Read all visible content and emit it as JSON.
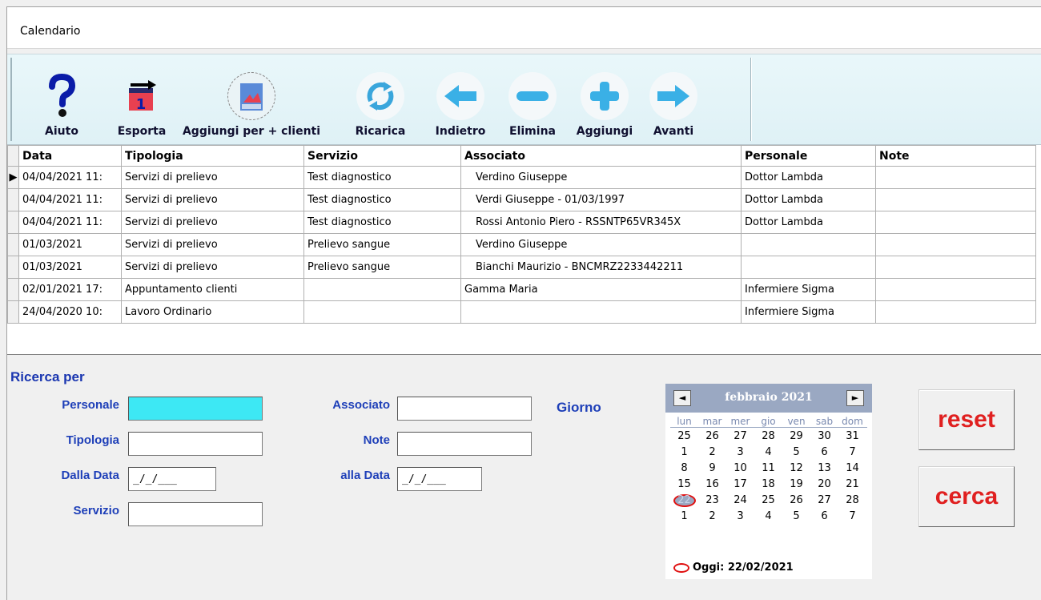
{
  "window": {
    "title": "Calendario"
  },
  "toolbar": {
    "buttons": [
      {
        "label": "Aiuto",
        "icon": "help-icon"
      },
      {
        "label": "Esporta",
        "icon": "export-icon"
      },
      {
        "label": "Aggiungi per + clienti",
        "icon": "add-multi-clients-icon"
      },
      {
        "label": "Ricarica",
        "icon": "reload-icon"
      },
      {
        "label": "Indietro",
        "icon": "arrow-left-icon"
      },
      {
        "label": "Elimina",
        "icon": "minus-icon"
      },
      {
        "label": "Aggiungi",
        "icon": "plus-icon"
      },
      {
        "label": "Avanti",
        "icon": "arrow-right-icon"
      }
    ]
  },
  "grid": {
    "columns": [
      "Data",
      "Tipologia",
      "Servizio",
      "Associato",
      "Personale",
      "Note"
    ],
    "rows": [
      {
        "data": "04/04/2021 11:",
        "tipologia": "Servizi di prelievo",
        "servizio": "Test diagnostico",
        "associato": "Verdino Giuseppe",
        "personale": "Dottor Lambda",
        "note": ""
      },
      {
        "data": "04/04/2021 11:",
        "tipologia": "Servizi di prelievo",
        "servizio": "Test diagnostico",
        "associato": "Verdi Giuseppe - 01/03/1997",
        "personale": "Dottor Lambda",
        "note": ""
      },
      {
        "data": "04/04/2021 11:",
        "tipologia": "Servizi di prelievo",
        "servizio": "Test diagnostico",
        "associato": "Rossi Antonio Piero - RSSNTP65VR345X",
        "personale": "Dottor Lambda",
        "note": ""
      },
      {
        "data": "01/03/2021",
        "tipologia": "Servizi di prelievo",
        "servizio": "Prelievo sangue",
        "associato": "Verdino Giuseppe",
        "personale": "",
        "note": ""
      },
      {
        "data": "01/03/2021",
        "tipologia": "Servizi di prelievo",
        "servizio": "Prelievo sangue",
        "associato": "Bianchi Maurizio - BNCMRZ2233442211",
        "personale": "",
        "note": ""
      },
      {
        "data": "02/01/2021 17:",
        "tipologia": "Appuntamento clienti",
        "servizio": "",
        "associato": "Gamma Maria",
        "personale": "Infermiere Sigma",
        "note": ""
      },
      {
        "data": "24/04/2020 10:",
        "tipologia": "Lavoro Ordinario",
        "servizio": "",
        "associato": "",
        "personale": "Infermiere Sigma",
        "note": ""
      }
    ]
  },
  "search": {
    "title": "Ricerca per",
    "personale_label": "Personale",
    "tipologia_label": "Tipologia",
    "dalla_data_label": "Dalla Data",
    "servizio_label": "Servizio",
    "associato_label": "Associato",
    "note_label": "Note",
    "alla_data_label": "alla Data",
    "giorno_label": "Giorno",
    "personale_value": "",
    "tipologia_value": "",
    "dalla_data_value": "_/_/___",
    "servizio_value": "",
    "associato_value": "",
    "note_value": "",
    "alla_data_value": "_/_/___"
  },
  "calendar": {
    "month_label": "febbraio 2021",
    "prev": "◄",
    "next": "►",
    "weekdays": [
      "lun",
      "mar",
      "mer",
      "gio",
      "ven",
      "sab",
      "dom"
    ],
    "weeks": [
      [
        "25",
        "26",
        "27",
        "28",
        "29",
        "30",
        "31"
      ],
      [
        "1",
        "2",
        "3",
        "4",
        "5",
        "6",
        "7"
      ],
      [
        "8",
        "9",
        "10",
        "11",
        "12",
        "13",
        "14"
      ],
      [
        "15",
        "16",
        "17",
        "18",
        "19",
        "20",
        "21"
      ],
      [
        "22",
        "23",
        "24",
        "25",
        "26",
        "27",
        "28"
      ],
      [
        "1",
        "2",
        "3",
        "4",
        "5",
        "6",
        "7"
      ]
    ],
    "today_label": "Oggi: 22/02/2021"
  },
  "buttons": {
    "reset": "reset",
    "cerca": "cerca"
  },
  "colors": {
    "accent_text": "#1e3fb8",
    "action_red": "#e02020",
    "active_field": "#3de8f4",
    "calendar_header": "#9aa8c2"
  }
}
